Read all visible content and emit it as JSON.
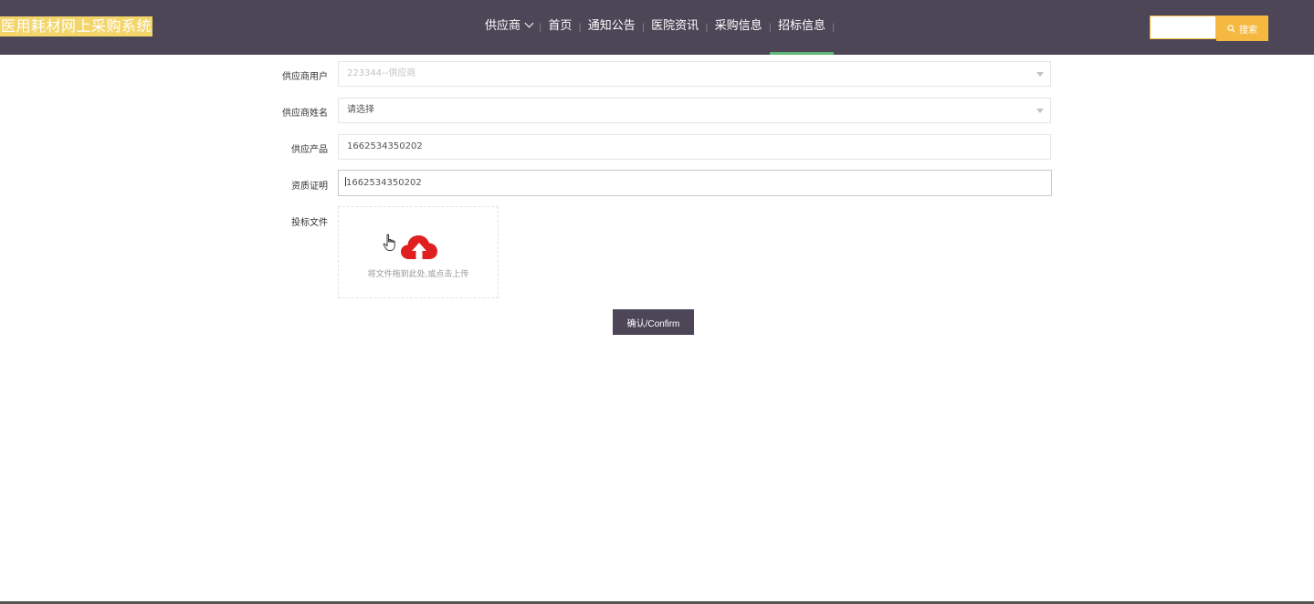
{
  "header": {
    "brand": "医用耗材网上采购系统",
    "nav": [
      {
        "label": "供应商",
        "has_dropdown": true
      },
      {
        "label": "首页"
      },
      {
        "label": "通知公告"
      },
      {
        "label": "医院资讯"
      },
      {
        "label": "采购信息"
      },
      {
        "label": "招标信息",
        "active": true
      }
    ],
    "separator": "|",
    "search": {
      "placeholder": "",
      "button_label": "搜索"
    }
  },
  "form": {
    "supplier_user": {
      "label": "供应商用户",
      "value": "223344--供应商"
    },
    "supplier_name": {
      "label": "供应商姓名",
      "value": "请选择"
    },
    "supplier_product": {
      "label": "供应产品",
      "value": "1662534350202"
    },
    "qualification": {
      "label": "资质证明",
      "value": "1662534350202"
    },
    "bid_file": {
      "label": "投标文件",
      "hint": "将文件拖到此处,或点击上传",
      "icon": "upload-cloud-icon"
    },
    "confirm_label": "确认/Confirm"
  },
  "colors": {
    "header_bg": "#4c4657",
    "brand_bg": "#f3d56a",
    "active_underline": "#5fb878",
    "search_accent": "#f5b942",
    "upload_icon": "#e02020"
  }
}
